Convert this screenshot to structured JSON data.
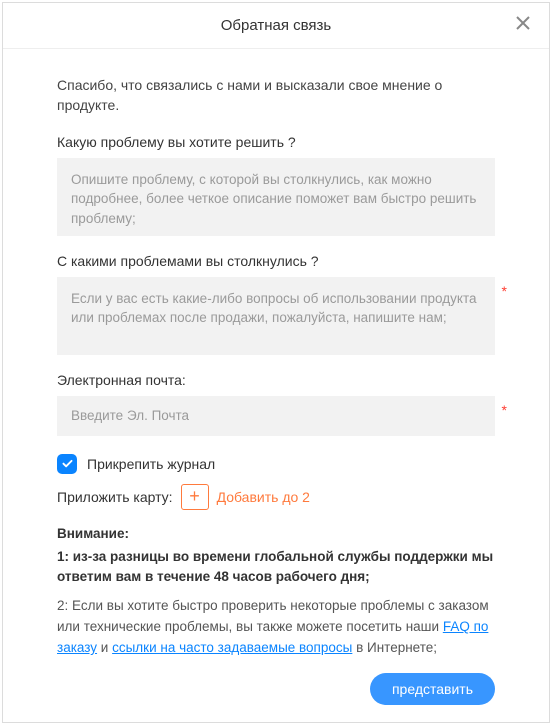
{
  "header": {
    "title": "Обратная связь"
  },
  "intro": "Спасибо, что связались с нами и высказали свое мнение о продукте.",
  "field1": {
    "label": "Какую проблему вы хотите решить ?",
    "placeholder": "Опишите проблему, с которой вы столкнулись, как можно подробнее, более четкое описание поможет вам быстро решить проблему;"
  },
  "field2": {
    "label": "С какими проблемами вы столкнулись ?",
    "placeholder": "Если у вас есть какие-либо вопросы об использовании продукта или проблемах после продажи, пожалуйста, напишите нам;",
    "required": "*"
  },
  "field3": {
    "label": "Электронная почта:",
    "placeholder": "Введите Эл. Почта",
    "required": "*"
  },
  "attach_log": "Прикрепить журнал",
  "attach_card_label": "Приложить карту:",
  "add_upto": "Добавить до 2",
  "notice": {
    "head": "Внимание:",
    "item1": "1: из-за разницы во времени глобальной службы поддержки мы ответим вам в течение 48 часов рабочего дня;",
    "item2_a": "2: Если вы хотите быстро проверить некоторые проблемы с заказом или технические проблемы, вы также можете посетить наши ",
    "link1": "FAQ по заказу",
    "and": " и ",
    "link2": "ссылки на часто задаваемые вопросы",
    "item2_b": " в Интернете;"
  },
  "submit_label": "представить"
}
